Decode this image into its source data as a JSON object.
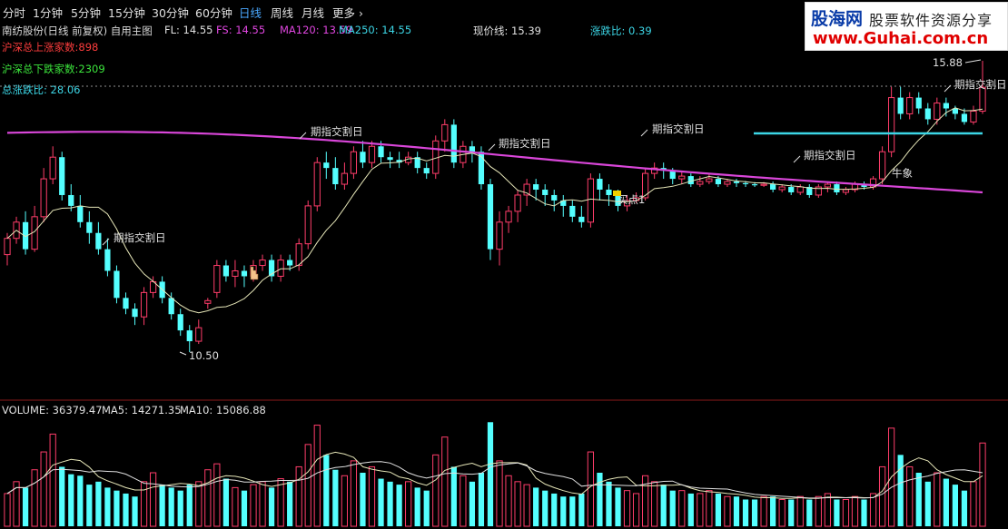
{
  "toolbar": {
    "periods": [
      "分时",
      "1分钟",
      "5分钟",
      "15分钟",
      "30分钟",
      "60分钟",
      "日线",
      "周线",
      "月线"
    ],
    "active_period": "日线",
    "more_label": "更多",
    "more_icon": "chevron-right-icon"
  },
  "logo": {
    "text_cn": "股海网",
    "slogan": "股票软件资源分享",
    "url": "www.Guhai.com.cn"
  },
  "main_info": {
    "stock_name": "南纺股份(日线 前复权) 自用主图",
    "fl": "FL: 14.55",
    "fs": "FS: 14.55",
    "ma120": "MA120: 13.59",
    "ma250": "MA250: 14.55",
    "current_line": "现价线: 15.39",
    "ratio": "涨跌比: 0.39"
  },
  "stats": {
    "up_count": "沪深总上涨家数:898",
    "down_count": "沪深总下跌家数:2309",
    "total_ratio": "总涨跌比: 28.06"
  },
  "annotations": [
    {
      "text": "期指交割日"
    },
    {
      "text": "期指交割日"
    },
    {
      "text": "期指交割日"
    },
    {
      "text": "期指交割日"
    },
    {
      "text": "期指交割日"
    },
    {
      "text": "期指交割日"
    },
    {
      "text": "买点1"
    },
    {
      "text": "牛象"
    }
  ],
  "price_labels": {
    "low": "10.50",
    "high": "15.88"
  },
  "volume_info": {
    "volume": "VOLUME: 36379.47",
    "ma5": "MA5: 14271.35",
    "ma10": "MA10: 15086.88"
  },
  "colors": {
    "up": "#ff3d6a",
    "down": "#54ffff",
    "ma_long": "#d946d9",
    "ma_short": "#e6e6b8",
    "current_line": "#3cd6e6",
    "text_red": "#ff3d3d",
    "text_green": "#3ce63c",
    "text_cyan": "#3cd6e6",
    "text_magenta": "#e046e0",
    "text_yellow": "#e6e64a",
    "active_period": "#4aa8ff"
  },
  "chart_data": {
    "type": "candlestick",
    "price_range": [
      10.5,
      15.88
    ],
    "candles": [
      [
        12.3,
        12.6,
        12.1,
        12.7
      ],
      [
        12.6,
        12.9,
        12.5,
        13.0
      ],
      [
        12.9,
        12.4,
        12.3,
        13.1
      ],
      [
        12.4,
        13.0,
        12.35,
        13.2
      ],
      [
        13.0,
        13.7,
        12.9,
        13.9
      ],
      [
        13.7,
        14.1,
        13.6,
        14.3
      ],
      [
        14.1,
        13.4,
        13.3,
        14.2
      ],
      [
        13.4,
        13.2,
        13.1,
        13.6
      ],
      [
        13.2,
        12.9,
        12.8,
        13.4
      ],
      [
        12.9,
        12.7,
        12.5,
        13.1
      ],
      [
        12.7,
        12.4,
        12.3,
        12.9
      ],
      [
        12.4,
        12.0,
        11.9,
        12.6
      ],
      [
        12.0,
        11.5,
        11.4,
        12.1
      ],
      [
        11.5,
        11.3,
        11.2,
        11.6
      ],
      [
        11.3,
        11.15,
        11.0,
        11.4
      ],
      [
        11.15,
        11.6,
        11.0,
        11.7
      ],
      [
        11.6,
        11.8,
        11.5,
        11.9
      ],
      [
        11.8,
        11.5,
        11.4,
        11.9
      ],
      [
        11.5,
        11.2,
        11.1,
        11.6
      ],
      [
        11.2,
        10.9,
        10.8,
        11.3
      ],
      [
        10.9,
        10.7,
        10.5,
        11.0
      ],
      [
        10.7,
        10.95,
        10.65,
        11.1
      ],
      [
        11.4,
        11.45,
        11.3,
        11.5
      ],
      [
        11.6,
        12.1,
        11.5,
        12.2
      ],
      [
        12.1,
        11.9,
        11.8,
        12.2
      ],
      [
        11.9,
        12.0,
        11.7,
        12.2
      ],
      [
        12.0,
        11.9,
        11.7,
        12.1
      ],
      [
        11.9,
        12.1,
        11.8,
        12.2
      ],
      [
        12.1,
        12.2,
        12.0,
        12.3
      ],
      [
        12.2,
        11.9,
        11.8,
        12.3
      ],
      [
        11.9,
        12.2,
        11.8,
        12.3
      ],
      [
        12.2,
        12.1,
        12.0,
        12.3
      ],
      [
        12.1,
        12.5,
        12.0,
        12.6
      ],
      [
        12.5,
        13.2,
        12.4,
        13.3
      ],
      [
        13.2,
        14.0,
        13.1,
        14.1
      ],
      [
        14.0,
        13.9,
        13.7,
        14.2
      ],
      [
        13.9,
        13.6,
        13.5,
        14.1
      ],
      [
        13.6,
        13.8,
        13.5,
        14.0
      ],
      [
        13.8,
        14.2,
        13.7,
        14.3
      ],
      [
        14.2,
        14.0,
        13.9,
        14.4
      ],
      [
        14.0,
        14.3,
        13.9,
        14.4
      ],
      [
        14.3,
        14.1,
        14.0,
        14.4
      ],
      [
        14.1,
        14.05,
        13.9,
        14.2
      ],
      [
        14.05,
        14.0,
        13.9,
        14.2
      ],
      [
        14.0,
        14.1,
        13.95,
        14.2
      ],
      [
        14.1,
        13.9,
        13.8,
        14.2
      ],
      [
        13.9,
        13.8,
        13.7,
        14.0
      ],
      [
        13.8,
        14.4,
        13.7,
        14.5
      ],
      [
        14.4,
        14.7,
        14.2,
        14.8
      ],
      [
        14.7,
        14.0,
        13.9,
        14.8
      ],
      [
        14.0,
        14.3,
        13.9,
        14.4
      ],
      [
        14.3,
        14.2,
        14.0,
        14.4
      ],
      [
        14.2,
        13.6,
        13.5,
        14.3
      ],
      [
        13.6,
        12.4,
        12.2,
        13.7
      ],
      [
        12.4,
        12.9,
        12.1,
        13.1
      ],
      [
        12.9,
        13.1,
        12.7,
        13.2
      ],
      [
        13.1,
        13.4,
        12.9,
        13.5
      ],
      [
        13.4,
        13.6,
        13.2,
        13.7
      ],
      [
        13.6,
        13.5,
        13.3,
        13.7
      ],
      [
        13.5,
        13.4,
        13.2,
        13.6
      ],
      [
        13.4,
        13.3,
        13.1,
        13.5
      ],
      [
        13.3,
        13.2,
        13.0,
        13.4
      ],
      [
        13.2,
        13.0,
        12.9,
        13.3
      ],
      [
        13.0,
        12.9,
        12.8,
        13.2
      ],
      [
        12.9,
        13.7,
        12.8,
        13.8
      ],
      [
        13.7,
        13.5,
        13.3,
        13.8
      ],
      [
        13.5,
        13.4,
        13.2,
        13.6
      ],
      [
        13.4,
        13.2,
        13.1,
        13.5
      ],
      [
        13.2,
        13.3,
        13.1,
        13.4
      ],
      [
        13.3,
        13.35,
        13.25,
        13.45
      ],
      [
        13.35,
        13.8,
        13.3,
        13.9
      ],
      [
        13.8,
        13.9,
        13.7,
        14.0
      ],
      [
        13.9,
        13.85,
        13.7,
        14.0
      ],
      [
        13.85,
        13.7,
        13.6,
        13.9
      ],
      [
        13.7,
        13.75,
        13.6,
        13.85
      ],
      [
        13.75,
        13.6,
        13.55,
        13.8
      ],
      [
        13.6,
        13.65,
        13.55,
        13.75
      ],
      [
        13.65,
        13.7,
        13.6,
        13.8
      ],
      [
        13.7,
        13.6,
        13.55,
        13.75
      ],
      [
        13.6,
        13.65,
        13.55,
        13.7
      ],
      [
        13.65,
        13.62,
        13.55,
        13.7
      ],
      [
        13.62,
        13.6,
        13.55,
        13.66
      ],
      [
        13.6,
        13.58,
        13.55,
        13.64
      ],
      [
        13.58,
        13.6,
        13.55,
        13.64
      ],
      [
        13.6,
        13.5,
        13.45,
        13.65
      ],
      [
        13.5,
        13.55,
        13.45,
        13.6
      ],
      [
        13.55,
        13.45,
        13.4,
        13.6
      ],
      [
        13.45,
        13.55,
        13.4,
        13.6
      ],
      [
        13.55,
        13.4,
        13.35,
        13.6
      ],
      [
        13.4,
        13.55,
        13.35,
        13.6
      ],
      [
        13.55,
        13.6,
        13.45,
        13.65
      ],
      [
        13.6,
        13.45,
        13.4,
        13.65
      ],
      [
        13.45,
        13.5,
        13.4,
        13.55
      ],
      [
        13.5,
        13.6,
        13.45,
        13.65
      ],
      [
        13.6,
        13.55,
        13.5,
        13.65
      ],
      [
        13.55,
        13.7,
        13.5,
        13.75
      ],
      [
        13.7,
        14.2,
        13.6,
        14.3
      ],
      [
        14.2,
        15.2,
        14.1,
        15.4
      ],
      [
        15.2,
        14.9,
        14.8,
        15.4
      ],
      [
        14.9,
        15.2,
        14.8,
        15.3
      ],
      [
        15.2,
        15.0,
        14.9,
        15.3
      ],
      [
        15.0,
        14.8,
        14.7,
        15.1
      ],
      [
        14.8,
        15.1,
        14.7,
        15.2
      ],
      [
        15.1,
        15.0,
        14.85,
        15.2
      ],
      [
        15.0,
        14.9,
        14.8,
        15.05
      ],
      [
        14.9,
        14.75,
        14.7,
        15.0
      ],
      [
        14.75,
        14.95,
        14.7,
        15.05
      ],
      [
        14.95,
        15.39,
        14.9,
        15.88
      ]
    ],
    "volumes": [
      22,
      30,
      26,
      38,
      50,
      62,
      40,
      35,
      34,
      28,
      30,
      26,
      24,
      22,
      20,
      30,
      36,
      28,
      26,
      24,
      28,
      30,
      38,
      42,
      32,
      26,
      24,
      28,
      30,
      26,
      32,
      30,
      40,
      55,
      68,
      48,
      38,
      34,
      44,
      36,
      40,
      32,
      30,
      28,
      30,
      26,
      24,
      48,
      60,
      40,
      34,
      30,
      36,
      70,
      44,
      34,
      30,
      28,
      26,
      24,
      22,
      20,
      20,
      22,
      50,
      36,
      30,
      26,
      24,
      22,
      34,
      30,
      28,
      24,
      24,
      22,
      22,
      24,
      22,
      20,
      20,
      18,
      18,
      20,
      20,
      18,
      18,
      20,
      18,
      20,
      22,
      18,
      18,
      20,
      18,
      22,
      40,
      66,
      48,
      40,
      36,
      30,
      36,
      32,
      28,
      24,
      30,
      56
    ],
    "ma_long_label": "MA250",
    "ma_short_label": "MA120"
  }
}
